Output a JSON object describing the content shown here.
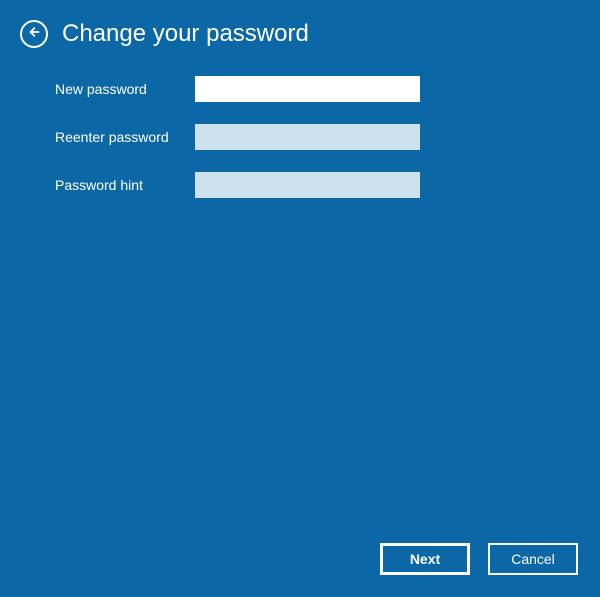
{
  "header": {
    "title": "Change your password"
  },
  "form": {
    "new_password_label": "New password",
    "new_password_value": "",
    "reenter_password_label": "Reenter password",
    "reenter_password_value": "",
    "password_hint_label": "Password hint",
    "password_hint_value": ""
  },
  "footer": {
    "next_label": "Next",
    "cancel_label": "Cancel"
  }
}
